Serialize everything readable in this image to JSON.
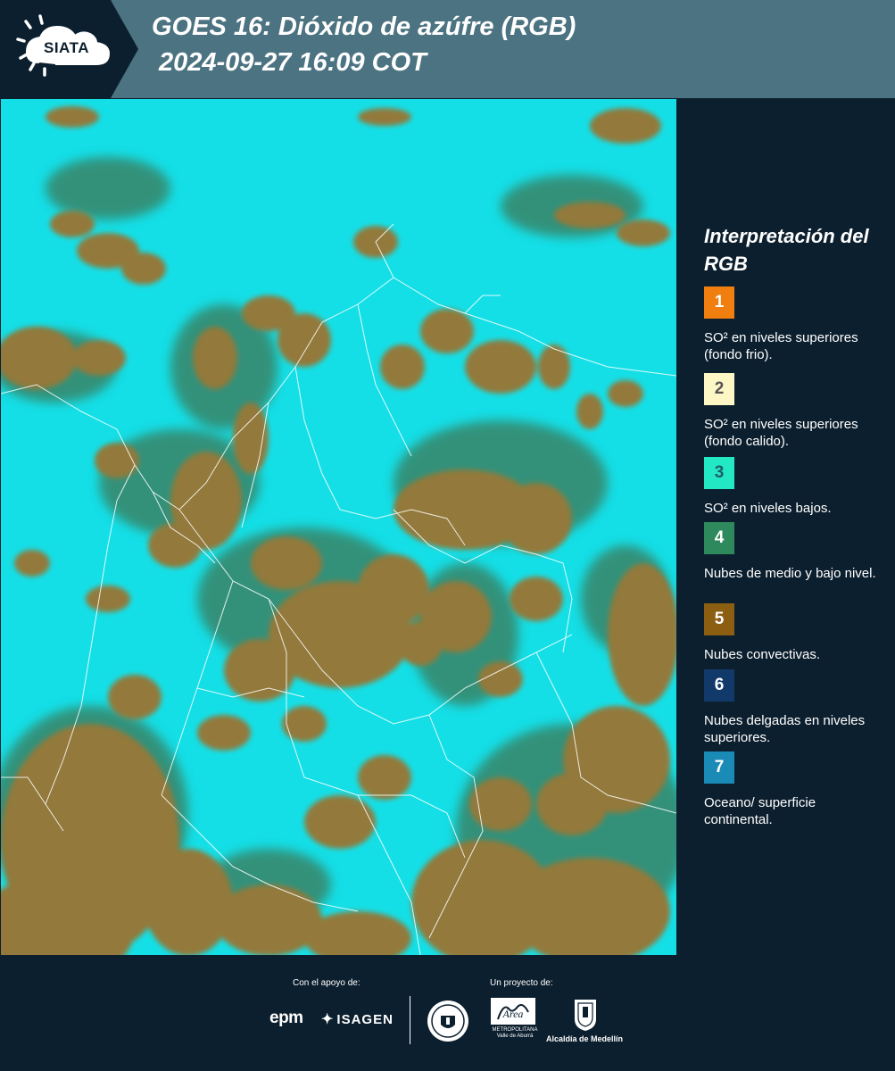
{
  "header": {
    "logo_text": "SIATA",
    "title_line1": "GOES 16: Dióxido de azúfre (RGB)",
    "title_line2": "2024-09-27 16:09 COT",
    "background_color": "#4c7381",
    "logo_panel_color": "#0c1f2e"
  },
  "legend": {
    "title": "Interpretación del RGB",
    "items": [
      {
        "number": "1",
        "label": "SO² en niveles superiores (fondo frio).",
        "color": "#f07f10",
        "number_color": "#ffffff"
      },
      {
        "number": "2",
        "label": "SO² en niveles superiores (fondo calido).",
        "color": "#fdf7c6",
        "number_color": "#555555"
      },
      {
        "number": "3",
        "label": "SO² en niveles bajos.",
        "color": "#22e8c4",
        "number_color": "#1e5c6b"
      },
      {
        "number": "4",
        "label": "Nubes de medio y bajo nivel.",
        "color": "#2e8a5c",
        "number_color": "#ffffff"
      },
      {
        "number": "5",
        "label": "Nubes convectivas.",
        "color": "#8c5e12",
        "number_color": "#ffffff"
      },
      {
        "number": "6",
        "label": "Nubes delgadas en niveles superiores.",
        "color": "#113a6a",
        "number_color": "#ffffff"
      },
      {
        "number": "7",
        "label": "Oceano/ superficie continental.",
        "color": "#1a8ab7",
        "number_color": "#ffffff"
      }
    ]
  },
  "map": {
    "colors": {
      "cyan": "#14dfe7",
      "brown": "#93793a",
      "green": "#3a7e5e",
      "borders": "#ffffff"
    }
  },
  "footer": {
    "support_label": "Con el apoyo de:",
    "project_label": "Un proyecto de:",
    "epm_logo": "epm",
    "isagen_logo": "ISAGEN",
    "area_logo_text": "METROPOLITANA Valle de Aburrá",
    "alcaldia_label": "Alcaldía de Medellín"
  }
}
